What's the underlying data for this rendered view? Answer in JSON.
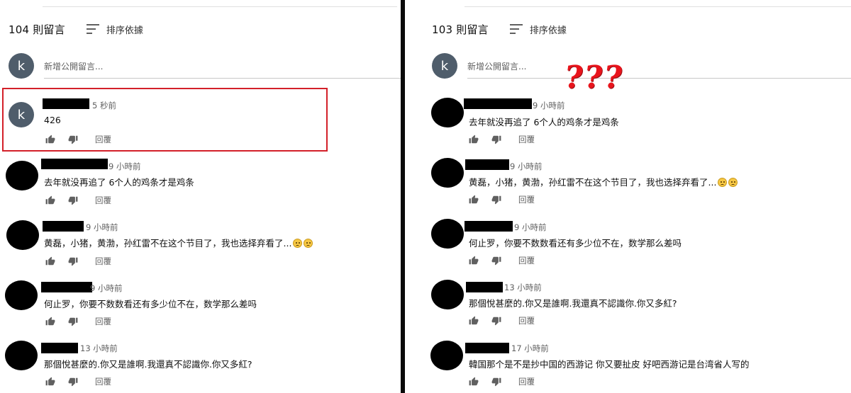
{
  "left": {
    "count": "104 則留言",
    "sort_label": "排序依據",
    "avatar_letter": "k",
    "add_placeholder": "新增公開留言...",
    "comments": [
      {
        "time": "5 秒前",
        "text": "426",
        "reply": "回覆"
      },
      {
        "time": "9 小時前",
        "text": "去年就没再追了 6个人的鸡条才是鸡条",
        "reply": "回覆"
      },
      {
        "time": "9 小時前",
        "text": "黄磊，小猪，黄渤，孙红雷不在这个节目了，我也选择弃看了...",
        "reply": "回覆"
      },
      {
        "time": "9 小時前",
        "text": "何止罗，你要不数数看还有多少位不在，数学那么差吗",
        "reply": "回覆"
      },
      {
        "time": "13 小時前",
        "text": "那個悅甚麼的.你又是誰啊.我還真不認識你.你又多紅?",
        "reply": "回覆"
      }
    ]
  },
  "right": {
    "count": "103 則留言",
    "sort_label": "排序依據",
    "avatar_letter": "k",
    "add_placeholder": "新增公開留言...",
    "annotation": "???",
    "comments": [
      {
        "time": "9 小時前",
        "text": "去年就没再追了 6个人的鸡条才是鸡条",
        "reply": "回覆"
      },
      {
        "time": "9 小時前",
        "text": "黄磊，小猪，黄渤，孙红雷不在这个节目了，我也选择弃看了...",
        "reply": "回覆"
      },
      {
        "time": "9 小時前",
        "text": "何止罗，你要不数数看还有多少位不在，数学那么差吗",
        "reply": "回覆"
      },
      {
        "time": "13 小時前",
        "text": "那個悅甚麼的.你又是誰啊.我還真不認識你.你又多紅?",
        "reply": "回覆"
      },
      {
        "time": "17 小時前",
        "text": "韓国那个是不是抄中国的西游记 你又要扯皮 好吧西游记是台湾省人写的",
        "reply": "回覆"
      }
    ]
  },
  "colors": {
    "highlight_border": "#d32029",
    "annotation": "#e8141c",
    "avatar_bg": "#4f5d6b",
    "divider": "#0a0a0a"
  },
  "icons": [
    "sort-icon",
    "thumbs-up-icon",
    "thumbs-down-icon",
    "frown-emoji-icon"
  ]
}
